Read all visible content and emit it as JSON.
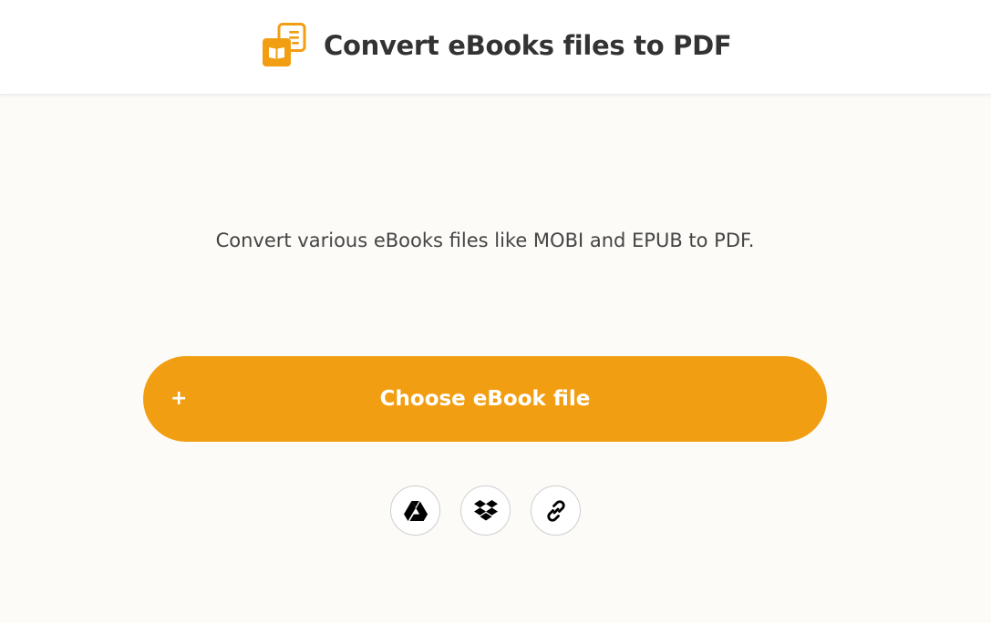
{
  "header": {
    "title": "Convert eBooks files to PDF",
    "logo_icon": "ebook-to-pdf-icon",
    "accent_color": "#f29e12"
  },
  "main": {
    "subtitle": "Convert various eBooks files like MOBI and EPUB to PDF.",
    "choose_button": {
      "icon": "+",
      "label": "Choose eBook file",
      "color": "#f29e12"
    },
    "sources": [
      {
        "name": "google-drive",
        "icon": "google-drive-icon"
      },
      {
        "name": "dropbox",
        "icon": "dropbox-icon"
      },
      {
        "name": "url-link",
        "icon": "link-icon"
      }
    ]
  }
}
